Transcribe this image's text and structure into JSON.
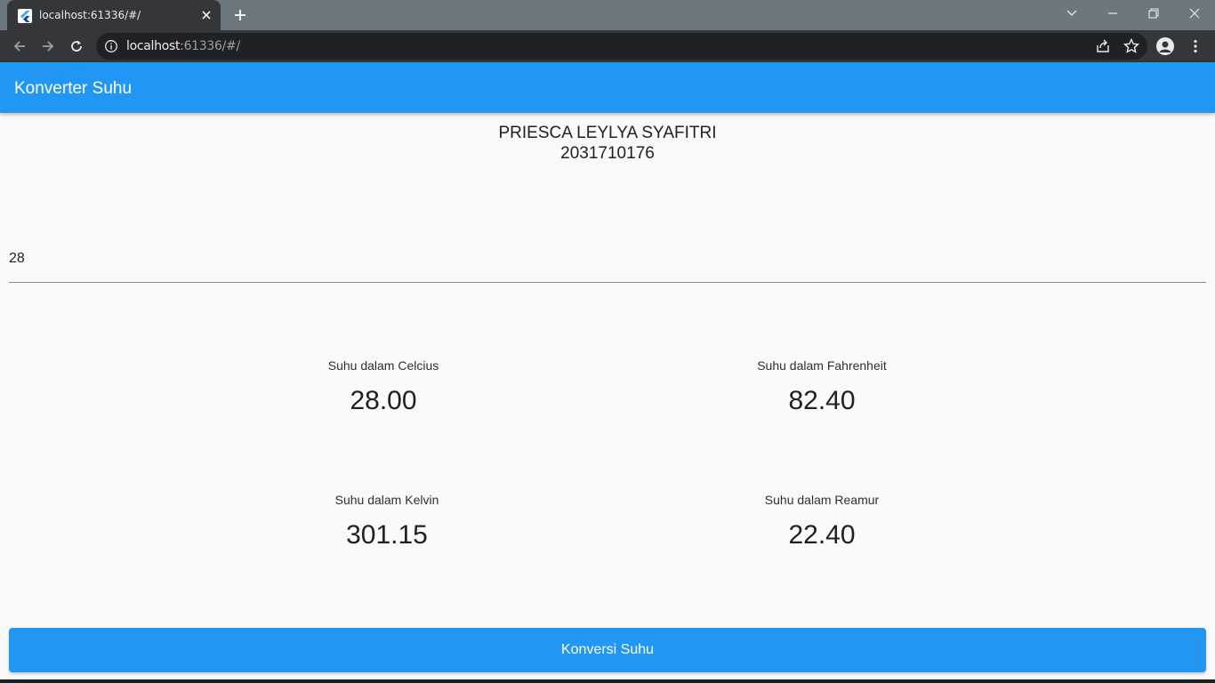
{
  "browser": {
    "tab_title": "localhost:61336/#/",
    "url_host": "localhost",
    "url_rest": ":61336/#/",
    "icons": [
      "flutter-favicon",
      "close-icon",
      "plus-icon",
      "chevron-down-icon",
      "minimize-icon",
      "restore-icon",
      "close-window-icon",
      "back-icon",
      "forward-icon",
      "reload-icon",
      "info-icon",
      "share-icon",
      "star-icon",
      "profile-icon",
      "kebab-menu-icon"
    ]
  },
  "app": {
    "title": "Konverter Suhu",
    "accent_color": "#2196f3",
    "student_name": "PRIESCA LEYLYA SYAFITRI",
    "student_id": "2031710176",
    "input_value": "28",
    "results": {
      "celcius": {
        "label": "Suhu dalam Celcius",
        "value": "28.00"
      },
      "fahrenheit": {
        "label": "Suhu dalam Fahrenheit",
        "value": "82.40"
      },
      "kelvin": {
        "label": "Suhu dalam Kelvin",
        "value": "301.15"
      },
      "reamur": {
        "label": "Suhu dalam Reamur",
        "value": "22.40"
      }
    },
    "convert_label": "Konversi Suhu"
  }
}
